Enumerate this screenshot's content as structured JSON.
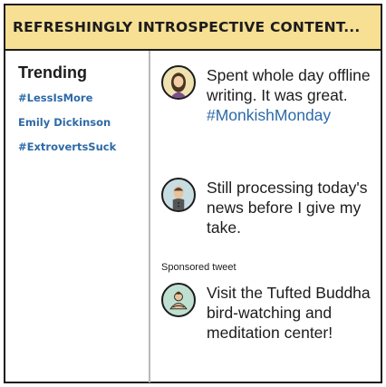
{
  "banner": {
    "title": "REFRESHINGLY INTROSPECTIVE CONTENT..."
  },
  "sidebar": {
    "title": "Trending",
    "items": [
      "#LessIsMore",
      "Emily Dickinson",
      "#ExtrovertsSuck"
    ]
  },
  "feed": {
    "tweets": [
      {
        "text": "Spent whole day offline writing. It was great.",
        "hashtag": "#MonkishMonday",
        "avatar_icon": "woman-avatar-icon"
      },
      {
        "text": "Still processing today's news before I give my take.",
        "avatar_icon": "man-avatar-icon"
      }
    ],
    "sponsored_label": "Sponsored tweet",
    "ad": {
      "text": "Visit the Tufted Buddha bird-watching and meditation center!",
      "avatar_icon": "buddha-avatar-icon"
    }
  },
  "colors": {
    "banner": "#f7df93",
    "link": "#2e6aa8",
    "avatar1": "#efe1b0",
    "avatar2": "#c7dde2",
    "avatar3": "#bfe0d0"
  }
}
